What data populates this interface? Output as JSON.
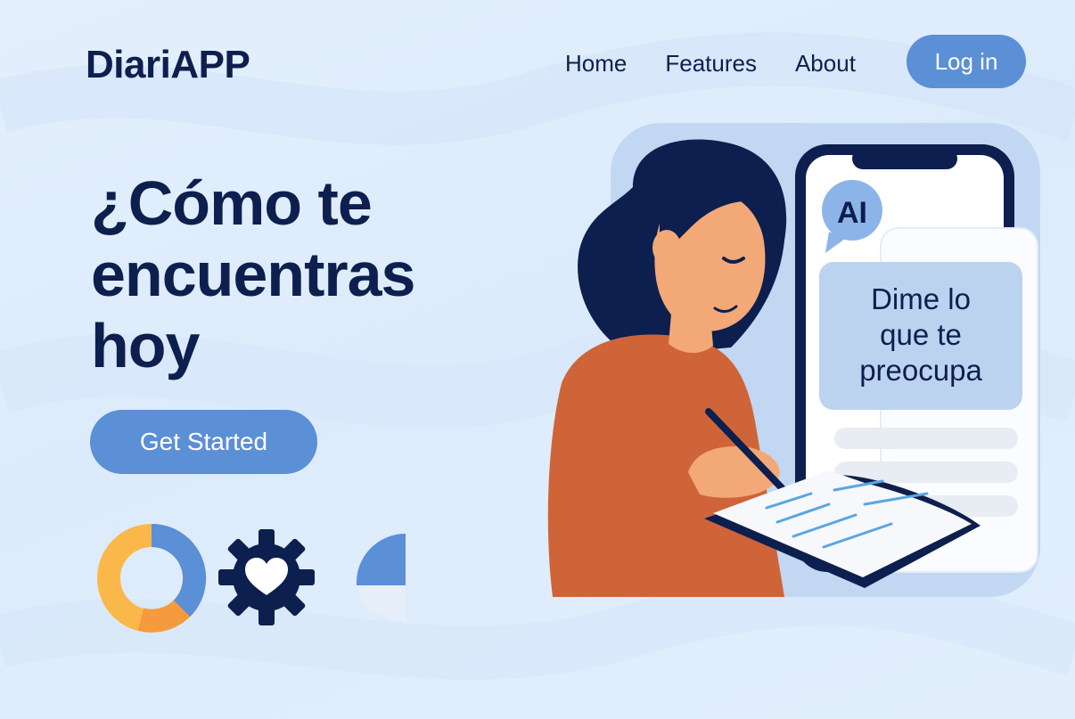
{
  "brand": {
    "name": "DiariAPP"
  },
  "nav": {
    "items": [
      "Home",
      "Features",
      "About"
    ],
    "login_label": "Log in"
  },
  "hero": {
    "title_lines": [
      "¿Cómo te",
      "encuentras",
      "hoy"
    ],
    "cta_label": "Get Started"
  },
  "illustration": {
    "ai_badge": "AI",
    "bubble_lines": [
      "Dime lo",
      "que te",
      "preocupa"
    ]
  },
  "icons": [
    "donut-chart-icon",
    "gear-heart-icon",
    "pie-quarter-icon"
  ],
  "colors": {
    "primary": "#5b8fd6",
    "navy": "#0d1f4e",
    "sweater": "#cf6438",
    "skin": "#f3a877",
    "donut_yellow": "#fbb84a",
    "donut_orange": "#f59a3d"
  }
}
